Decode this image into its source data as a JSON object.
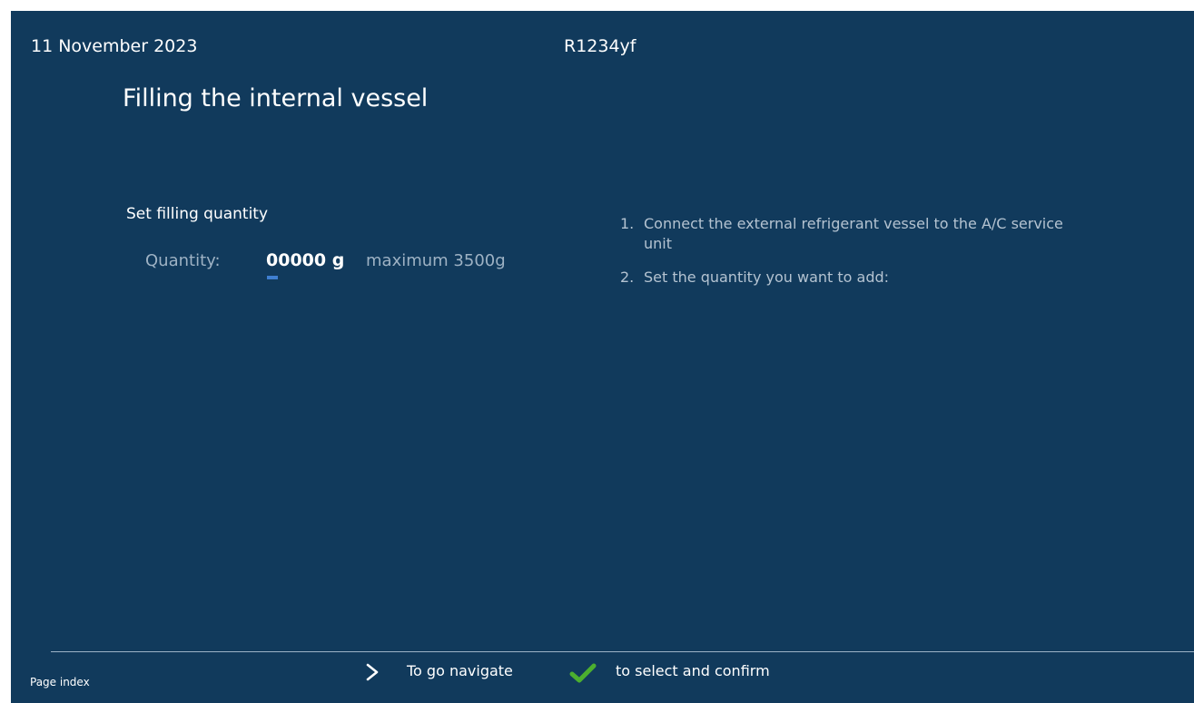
{
  "header": {
    "date": "11 November 2023",
    "refrigerant": "R1234yf"
  },
  "page": {
    "title": "Filling the internal vessel"
  },
  "form": {
    "section_title": "Set filling quantity",
    "quantity_label": "Quantity:",
    "quantity_value": "00000 g",
    "maximum_text": "maximum 3500g"
  },
  "instructions": {
    "steps": [
      {
        "number": "1.",
        "text": "Connect the external refrigerant vessel to the A/C service unit"
      },
      {
        "number": "2.",
        "text": "Set the quantity you want to add:"
      }
    ]
  },
  "footer": {
    "page_index": "Page index",
    "navigate_icon": "chevron-right-icon",
    "navigate_text": "To go navigate",
    "confirm_icon": "check-icon",
    "confirm_text": "to select and confirm"
  },
  "colors": {
    "background": "#113a5c",
    "text_primary": "#ffffff",
    "text_muted": "#9eb2c4",
    "check_green": "#4caf2f",
    "cursor_blue": "#3f7fd0"
  }
}
